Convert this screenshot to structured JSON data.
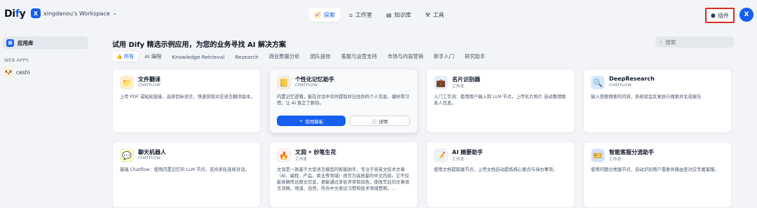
{
  "header": {
    "logo_main": "Di",
    "logo_dot": "f",
    "logo_end": "y",
    "workspace_badge": "X",
    "workspace_name": "xingdanou's Workspace",
    "nav": [
      {
        "label": "探索",
        "icon": "compass-icon",
        "active": true
      },
      {
        "label": "工作室",
        "icon": "studio-icon",
        "active": false
      },
      {
        "label": "知识库",
        "icon": "book-icon",
        "active": false
      },
      {
        "label": "工具",
        "icon": "tool-icon",
        "active": false
      }
    ],
    "plugin_label": "插件",
    "avatar_initial": "X"
  },
  "sidebar": {
    "active_label": "应用库",
    "section_label": "WEB APPS",
    "apps": [
      {
        "label": "ceshi",
        "icon": "dog-emoji"
      }
    ]
  },
  "main": {
    "heading": "试用 Dify 精选示例应用，为您的业务寻找 AI 解决方案",
    "search_placeholder": "搜索",
    "categories": [
      "所有",
      "AI 编程",
      "Knowledge Retrieval",
      "Research",
      "商业数据分析",
      "团队提效",
      "客服与运营支持",
      "市场与内容营销",
      "新手入门",
      "研究助手"
    ],
    "cards": [
      {
        "title": "文件翻译",
        "type": "CHATFLOW",
        "icon": "📁",
        "icon_bg": "#fef0c7",
        "desc": "上传 PDF 或粘贴链接，选择目标语言，快速获取对应语言翻译版本。"
      },
      {
        "title": "个性化记忆助手",
        "type": "CHATFLOW",
        "icon": "📒",
        "icon_bg": "#fdead7",
        "desc": "内置记忆逻辑，能在对话中实时提取并记住你的个人信息、偏好和习惯，让 AI 真正了解你。"
      },
      {
        "title": "名片识别器",
        "type": "工作流",
        "icon": "💼",
        "icon_bg": "#e0f2fe",
        "desc": "入门工作流：使用用户输入和 LLM 节点，上传名片照片 自动整理联系人信息。"
      },
      {
        "title": "DeepResearch",
        "type": "CHATFLOW",
        "icon": "🔍",
        "icon_bg": "#d1e9ff",
        "desc": "输入想要搜索的内容，系统就会反复执行搜索并生成报告"
      },
      {
        "title": "聊天机器人",
        "type": "CHATFLOW",
        "icon": "💬",
        "icon_bg": "#fef7c3",
        "desc": "基础 Chatflow：使用内置记忆的 LLM 节点，支持多轮连续对话。"
      },
      {
        "title": "文润 • 妙笔生花",
        "type": "工作流",
        "icon": "🔥",
        "icon_bg": "#fff4ed",
        "desc": "文润是一款基于大型语言模型的智能助手，专注于将英文技术文章（AI、编程、产品、商业等领域）改写为高质量的中文内容。它不仅能准确传达原文信息，更能通过多轮评审和润色，使改写后的文章语言流畅、地道、自然，符合中文表达习惯和技术领域惯例。..."
      },
      {
        "title": "AI 摘要助手",
        "type": "工作流",
        "icon": "📝",
        "icon_bg": "#f2f4f7",
        "desc": "使用文档提取器节点，上传文档自动提炼核心要点与待办事项。"
      },
      {
        "title": "智能客服分流助手",
        "type": "工作流",
        "icon": "🎫",
        "icon_bg": "#d1e0ff",
        "desc": "使用问题分类器节点，自动识别用户需要并路由至对应专属客服。"
      }
    ],
    "use_template_label": "使用模板",
    "detail_label": "详情"
  }
}
